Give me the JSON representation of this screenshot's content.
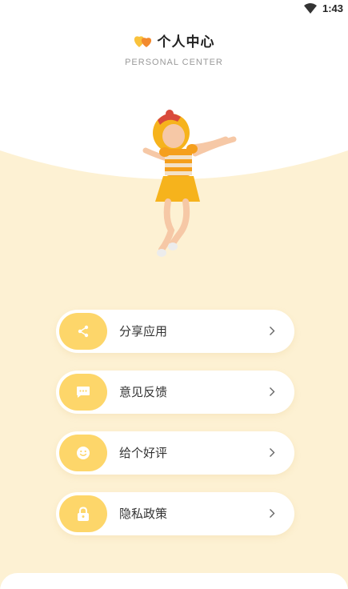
{
  "status_bar": {
    "time": "1:43"
  },
  "header": {
    "title": "个人中心",
    "subtitle": "PERSONAL CENTER"
  },
  "colors": {
    "accent": "#fdd66a",
    "background_wave": "#fdf1d3"
  },
  "menu": [
    {
      "label": "分享应用",
      "icon": "share-icon"
    },
    {
      "label": "意见反馈",
      "icon": "chat-icon"
    },
    {
      "label": "给个好评",
      "icon": "smile-icon"
    },
    {
      "label": "隐私政策",
      "icon": "lock-icon"
    }
  ]
}
